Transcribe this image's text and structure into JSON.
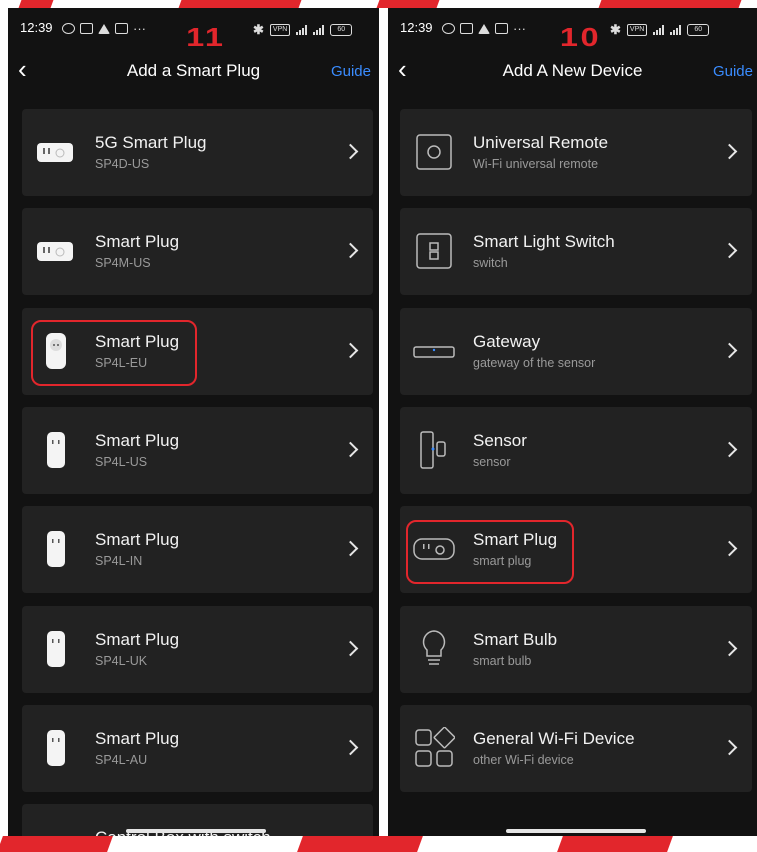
{
  "left_screen": {
    "status": {
      "time": "12:39",
      "overflow": "···",
      "battery": "60"
    },
    "step_badge": "11",
    "nav": {
      "title": "Add a Smart Plug",
      "guide": "Guide"
    },
    "items": [
      {
        "name": "5G Smart Plug",
        "model": "SP4D-US",
        "icon": "wide-us-plug-icon"
      },
      {
        "name": "Smart Plug",
        "model": "SP4M-US",
        "icon": "wide-us-plug-icon"
      },
      {
        "name": "Smart Plug",
        "model": "SP4L-EU",
        "icon": "eu-plug-icon"
      },
      {
        "name": "Smart Plug",
        "model": "SP4L-US",
        "icon": "tall-plug-icon"
      },
      {
        "name": "Smart Plug",
        "model": "SP4L-IN",
        "icon": "tall-plug-icon"
      },
      {
        "name": "Smart Plug",
        "model": "SP4L-UK",
        "icon": "tall-plug-icon"
      },
      {
        "name": "Smart Plug",
        "model": "SP4L-AU",
        "icon": "tall-plug-icon"
      },
      {
        "name": "Control Box with switch",
        "model": "",
        "icon": "control-box-icon"
      }
    ],
    "highlighted_item_index": 2
  },
  "right_screen": {
    "status": {
      "time": "12:39",
      "overflow": "···",
      "battery": "60"
    },
    "step_badge": "10",
    "nav": {
      "title": "Add A New Device",
      "guide": "Guide"
    },
    "items": [
      {
        "name": "Universal Remote",
        "subtitle": "Wi-Fi universal remote",
        "icon": "universal-remote-icon"
      },
      {
        "name": "Smart Light Switch",
        "subtitle": "switch",
        "icon": "light-switch-icon"
      },
      {
        "name": "Gateway",
        "subtitle": "gateway of the sensor",
        "icon": "gateway-icon"
      },
      {
        "name": "Sensor",
        "subtitle": "sensor",
        "icon": "door-sensor-icon"
      },
      {
        "name": "Smart Plug",
        "subtitle": "smart plug",
        "icon": "smart-plug-outline-icon"
      },
      {
        "name": "Smart Bulb",
        "subtitle": "smart bulb",
        "icon": "light-bulb-icon"
      },
      {
        "name": "General Wi-Fi Device",
        "subtitle": "other Wi-Fi device",
        "icon": "wifi-device-grid-icon"
      }
    ],
    "highlighted_item_index": 4
  },
  "colors": {
    "annotation_red": "#e2262c",
    "guide_blue": "#3a8cff",
    "card_bg": "#222222",
    "screen_bg": "#121212"
  }
}
